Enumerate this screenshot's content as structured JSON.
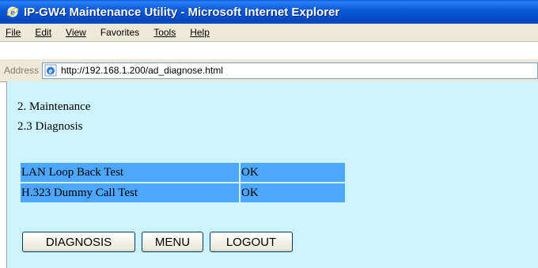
{
  "window": {
    "title": "IP-GW4 Maintenance Utility - Microsoft Internet Explorer"
  },
  "menubar": {
    "items": [
      {
        "label": "File"
      },
      {
        "label": "Edit"
      },
      {
        "label": "View"
      },
      {
        "label": "Favorites"
      },
      {
        "label": "Tools"
      },
      {
        "label": "Help"
      }
    ]
  },
  "address": {
    "label": "Address",
    "url": "http://192.168.1.200/ad_diagnose.html"
  },
  "page": {
    "section": "2. Maintenance",
    "subsection": "2.3 Diagnosis",
    "results": [
      {
        "test": "LAN Loop Back Test",
        "status": "OK"
      },
      {
        "test": "H.323 Dummy Call Test",
        "status": "OK"
      }
    ],
    "buttons": {
      "diagnosis": "DIAGNOSIS",
      "menu": "MENU",
      "logout": "LOGOUT"
    }
  },
  "colors": {
    "content_bg": "#ccf3fe",
    "table_cell": "#4da6ff",
    "titlebar": "#0548c4"
  }
}
